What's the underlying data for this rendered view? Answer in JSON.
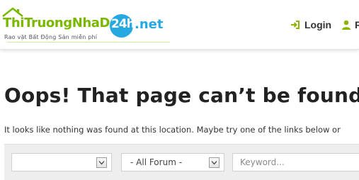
{
  "header": {
    "logo": {
      "brand_main": "ThiTruongNhaDat",
      "brand_number": "24h",
      "brand_tld": ".net",
      "tagline": "Rao vặt Bất Động Sản miễn phí",
      "colors": {
        "green": "#7ab800",
        "blue": "#25a9e0"
      }
    },
    "nav": {
      "login_label": "Login",
      "login_icon": "sign-in-icon",
      "register_label": "R",
      "register_icon": "user-icon",
      "icon_color": "#8cb400"
    }
  },
  "main": {
    "title": "Oops! That page can’t be found.",
    "description": "It looks like nothing was found at this location. Maybe try one of the links below or"
  },
  "search": {
    "category_select_value": "",
    "forum_select_value": "- All Forum -",
    "keyword_placeholder": "Keyword...",
    "keyword_value": ""
  }
}
